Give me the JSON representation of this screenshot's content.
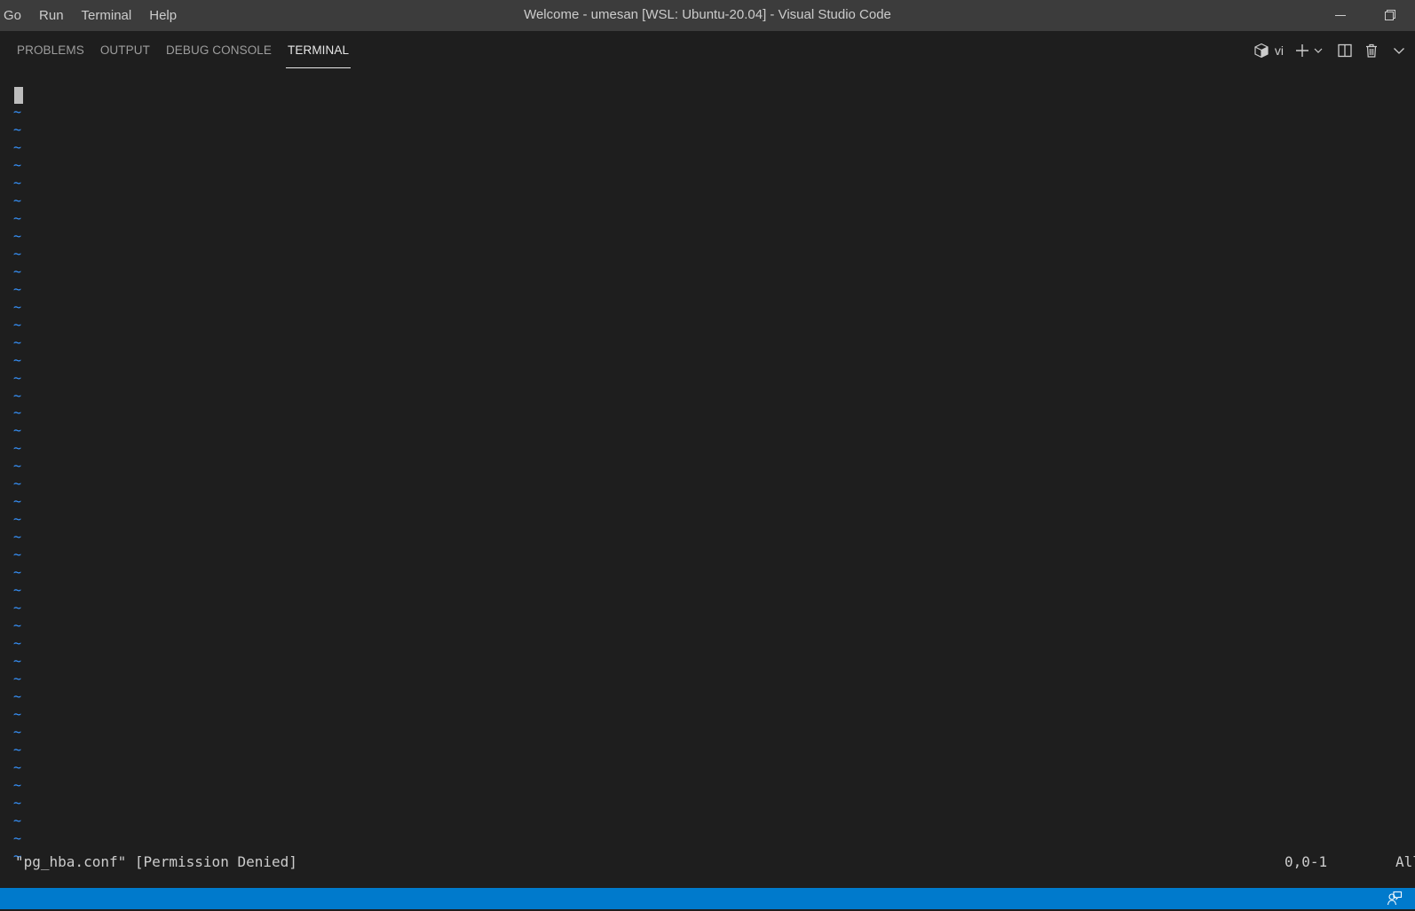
{
  "titlebar": {
    "menu": [
      "Go",
      "Run",
      "Terminal",
      "Help"
    ],
    "window_title": "Welcome - umesan [WSL: Ubuntu-20.04] - Visual Studio Code"
  },
  "panel": {
    "tabs": [
      {
        "label": "PROBLEMS",
        "active": false
      },
      {
        "label": "OUTPUT",
        "active": false
      },
      {
        "label": "DEBUG CONSOLE",
        "active": false
      },
      {
        "label": "TERMINAL",
        "active": true
      }
    ],
    "terminal_name": "vi",
    "icons": [
      "terminal-icon",
      "plus-icon",
      "chevron-down-icon",
      "split-terminal-icon",
      "trash-icon",
      "chevron-down-icon"
    ]
  },
  "terminal": {
    "tilde": "~",
    "tilde_count": 43,
    "message": "\"pg_hba.conf\" [Permission Denied]",
    "position": "0,0-1",
    "scroll": "All",
    "tilde_color": "#3794ff"
  },
  "statusbar": {
    "color": "#007acc",
    "icons": [
      "feedback-icon"
    ]
  }
}
